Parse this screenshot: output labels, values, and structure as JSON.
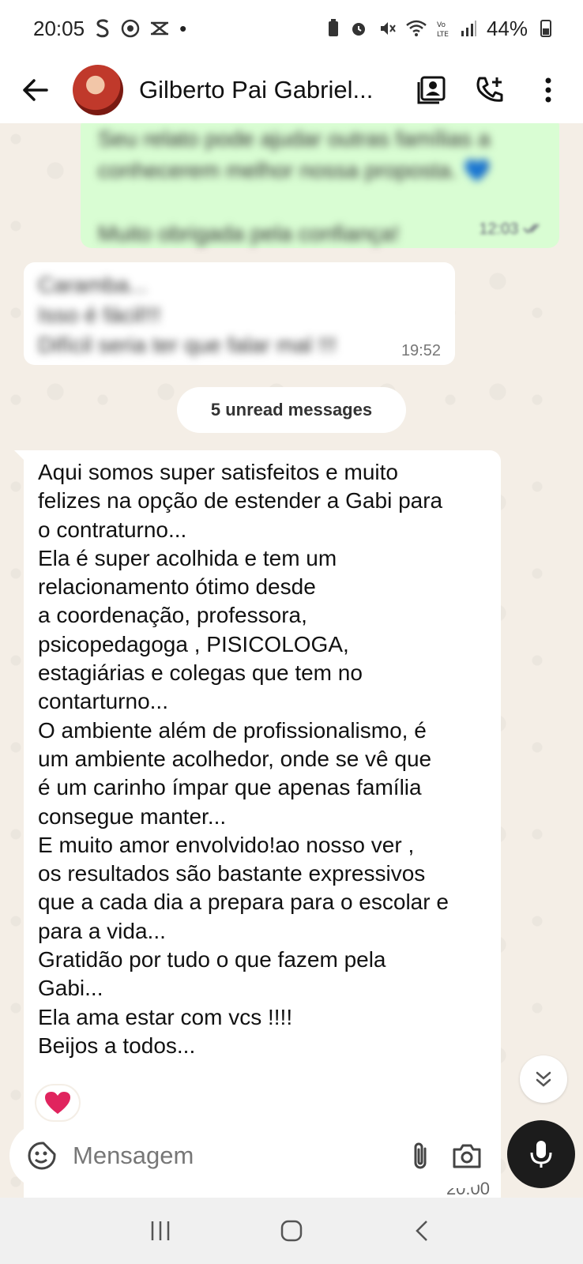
{
  "status_bar": {
    "time": "20:05",
    "notif_icons": [
      "s-icon",
      "chrome-icon",
      "scissors-icon"
    ],
    "dot": "•",
    "battery": "44%"
  },
  "header": {
    "contact_name": "Gilberto Pai Gabriel...",
    "icons": [
      "back-arrow-icon",
      "contact-card-icon",
      "add-call-icon",
      "more-vert-icon"
    ]
  },
  "chat": {
    "outgoing_blurred": {
      "lines": [
        "Seu relato pode ajudar outras famílias a",
        "conhecerem melhor nossa proposta. 💙",
        "",
        "Muito obrigada pela confiança!"
      ],
      "time": "12:03"
    },
    "incoming_blurred": {
      "lines": [
        "Caramba...",
        "Isso é fácil!!!",
        "Difícil seria ter que falar mal !!!"
      ],
      "time": "19:52"
    },
    "unread_label": "5 unread messages",
    "message": {
      "lines": [
        "Aqui somos super satisfeitos e muito",
        "felizes na opção de estender a Gabi para",
        "o contraturno...",
        "Ela é super acolhida e tem um",
        "relacionamento ótimo desde",
        "a coordenação, professora,",
        "psicopedagoga , PISICOLOGA,",
        "estagiárias  e colegas que tem no",
        "contarturno...",
        "O ambiente além de profissionalismo,  é",
        "um ambiente acolhedor, onde se vê que",
        "é um carinho ímpar que apenas família",
        "consegue manter...",
        "E muito amor envolvido!ao nosso ver ,",
        "os resultados são bastante expressivos",
        "que a cada dia a prepara para o escolar e",
        "para a vida...",
        "Gratidão por tudo o que fazem pela",
        "Gabi...",
        "Ela ama estar com vcs !!!!",
        "Beijos a todos..."
      ],
      "time": "20:00",
      "reaction": "heart-icon"
    }
  },
  "input": {
    "placeholder": "Mensagem"
  },
  "colors": {
    "outgoing_bubble": "#d9fdd3",
    "incoming_bubble": "#ffffff",
    "chat_background": "#f4eee6",
    "reaction_heart": "#e0245e"
  }
}
